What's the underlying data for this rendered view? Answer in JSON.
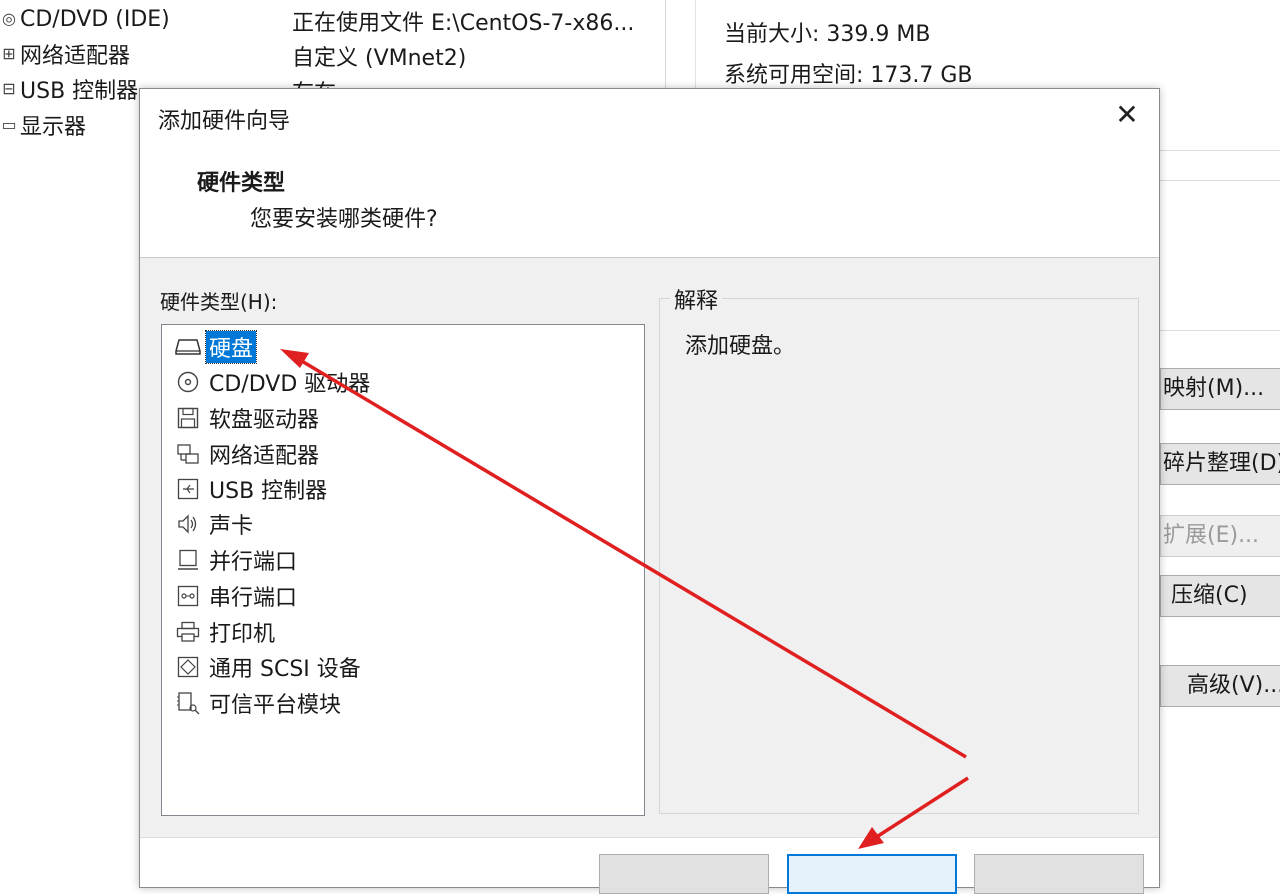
{
  "device_list": [
    {
      "name": "CD/DVD (IDE)",
      "summary": "正在使用文件 E:\\CentOS-7-x86...",
      "icon": "cd-icon"
    },
    {
      "name": "网络适配器",
      "summary": "自定义 (VMnet2)",
      "icon": "network-icon"
    },
    {
      "name": "USB 控制器",
      "summary": "存在",
      "icon": "usb-icon"
    },
    {
      "name": "显示器",
      "summary": "",
      "icon": "monitor-icon"
    }
  ],
  "capacity": {
    "current_size": "当前大小: 339.9 MB",
    "free_space": "系统可用空间: 173.7 GB"
  },
  "side_buttons": {
    "map": "映射(M)...",
    "defragment": "碎片整理(D)",
    "expand": "扩展(E)...",
    "compact": "压缩(C)",
    "advanced": "高级(V)..."
  },
  "dialog": {
    "title": "添加硬件向导",
    "header_title": "硬件类型",
    "header_subtitle": "您要安装哪类硬件?",
    "list_label": "硬件类型(H):",
    "hardware_types": [
      {
        "label": "硬盘",
        "icon": "hard-disk-icon",
        "selected": true
      },
      {
        "label": "CD/DVD 驱动器",
        "icon": "cd-dvd-drive-icon"
      },
      {
        "label": "软盘驱动器",
        "icon": "floppy-icon"
      },
      {
        "label": "网络适配器",
        "icon": "network-adapter-icon"
      },
      {
        "label": "USB 控制器",
        "icon": "usb-controller-icon"
      },
      {
        "label": "声卡",
        "icon": "speaker-icon"
      },
      {
        "label": "并行端口",
        "icon": "parallel-port-icon"
      },
      {
        "label": "串行端口",
        "icon": "serial-port-icon"
      },
      {
        "label": "打印机",
        "icon": "printer-icon"
      },
      {
        "label": "通用 SCSI 设备",
        "icon": "scsi-device-icon"
      },
      {
        "label": "可信平台模块",
        "icon": "tpm-icon"
      }
    ],
    "explanation_title": "解释",
    "explanation_text": "添加硬盘。"
  },
  "colors": {
    "selection": "#0078d7",
    "annotation_arrow": "#e02020",
    "dialog_body": "#f0f0f0"
  }
}
